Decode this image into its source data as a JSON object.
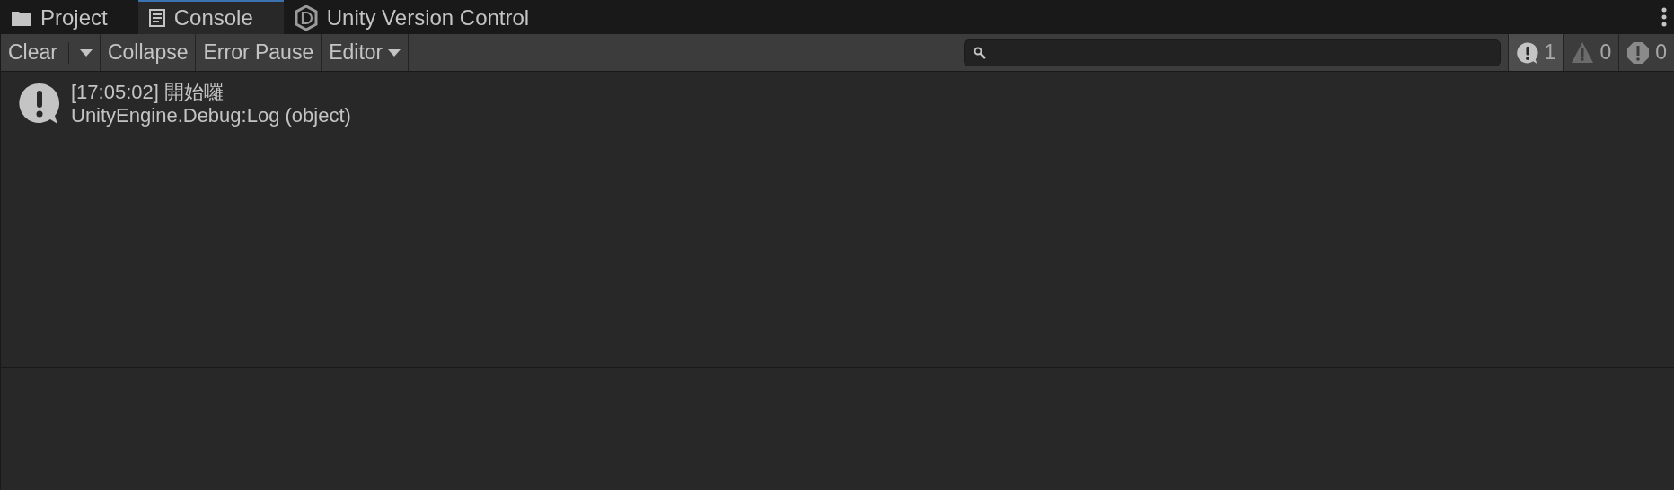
{
  "tabs": [
    {
      "label": "Project",
      "kind": "folder",
      "selected": false
    },
    {
      "label": "Console",
      "kind": "console",
      "selected": true
    },
    {
      "label": "Unity Version Control",
      "kind": "vcs",
      "selected": false
    }
  ],
  "toolbar": {
    "clear": {
      "label": "Clear"
    },
    "collapse": {
      "label": "Collapse",
      "on": false
    },
    "error_pause": {
      "label": "Error Pause",
      "on": false
    },
    "editor": {
      "label": "Editor"
    },
    "counters": [
      {
        "kind": "log",
        "count": "1",
        "selected": true
      },
      {
        "kind": "warning",
        "count": "0",
        "selected": false
      },
      {
        "kind": "error",
        "count": "0",
        "selected": false
      }
    ]
  },
  "entries": [
    {
      "kind": "log",
      "line1": "[17:05:02] 開始囉",
      "line2": "UnityEngine.Debug:Log (object)",
      "selected": false
    }
  ]
}
